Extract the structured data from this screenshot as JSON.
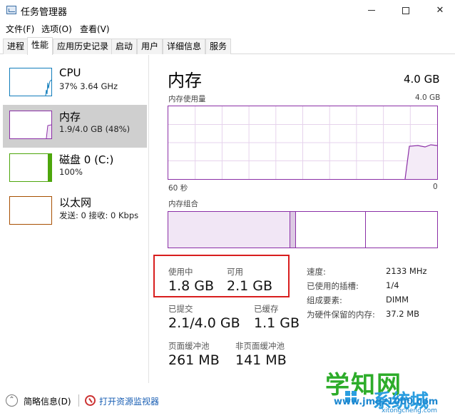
{
  "window": {
    "title": "任务管理器",
    "controls": {
      "minimize": "minimize-icon",
      "maximize": "maximize-icon",
      "close": "✕"
    }
  },
  "menu": [
    "文件(F)",
    "选项(O)",
    "查看(V)"
  ],
  "tabs": [
    "进程",
    "性能",
    "应用历史记录",
    "启动",
    "用户",
    "详细信息",
    "服务"
  ],
  "active_tab": "性能",
  "sidebar": {
    "items": [
      {
        "name": "CPU",
        "sub": "37%  3.64 GHz",
        "color": "#117dbb"
      },
      {
        "name": "内存",
        "sub": "1.9/4.0 GB (48%)",
        "color": "#8b2fa6"
      },
      {
        "name": "磁盘 0 (C:)",
        "sub": "100%",
        "color": "#4da60c"
      },
      {
        "name": "以太网",
        "sub": "发送: 0  接收: 0 Kbps",
        "color": "#a74f01"
      }
    ],
    "selected": "内存"
  },
  "main": {
    "title": "内存",
    "total": "4.0 GB",
    "usage_label": "内存使用量",
    "usage_max": "4.0 GB",
    "time_left": "60 秒",
    "time_right": "0",
    "composition_label": "内存组合",
    "accent": "#8b2fa6"
  },
  "stats": {
    "in_use_label": "使用中",
    "in_use_value": "1.8 GB",
    "available_label": "可用",
    "available_value": "2.1 GB",
    "committed_label": "已提交",
    "committed_value": "2.1/4.0 GB",
    "cached_label": "已缓存",
    "cached_value": "1.1 GB",
    "paged_label": "页面缓冲池",
    "paged_value": "261 MB",
    "nonpaged_label": "非页面缓冲池",
    "nonpaged_value": "141 MB"
  },
  "details": [
    {
      "label": "速度:",
      "value": "2133 MHz"
    },
    {
      "label": "已使用的插槽:",
      "value": "1/4"
    },
    {
      "label": "组成要素:",
      "value": "DIMM"
    },
    {
      "label": "为硬件保留的内存:",
      "value": "37.2 MB"
    }
  ],
  "footer": {
    "brief": "简略信息(D)",
    "monitor": "打开资源监视器"
  },
  "watermark": {
    "main": "学知网",
    "sub": "系统城",
    "url": "www.jmqz1000.com",
    "domain": "xitongcheng.com"
  }
}
